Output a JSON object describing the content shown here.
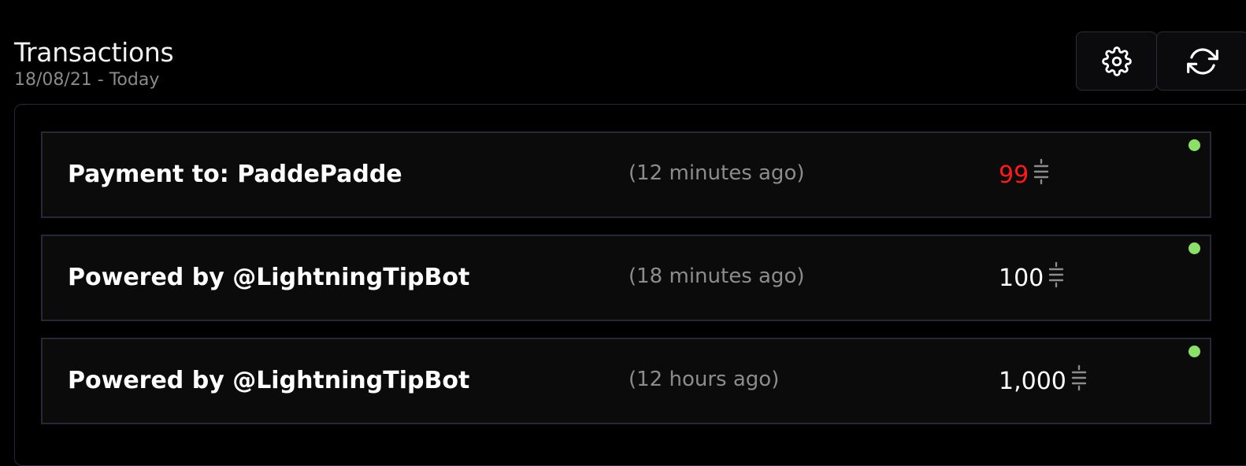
{
  "header": {
    "title": "Transactions",
    "date_range": "18/08/21 - Today"
  },
  "toolbar": {
    "settings_icon": "gear-icon",
    "refresh_icon": "refresh-icon"
  },
  "colors": {
    "positive": "#ffffff",
    "negative": "#ff1a1a",
    "status_ok": "#8be06a"
  },
  "transactions": [
    {
      "description": "Payment to: PaddePadde",
      "time": "(12 minutes ago)",
      "amount": "99",
      "direction": "outgoing",
      "status": "settled"
    },
    {
      "description": "Powered by @LightningTipBot",
      "time": "(18 minutes ago)",
      "amount": "100",
      "direction": "incoming",
      "status": "settled"
    },
    {
      "description": "Powered by @LightningTipBot",
      "time": "(12 hours ago)",
      "amount": "1,000",
      "direction": "incoming",
      "status": "settled"
    }
  ]
}
